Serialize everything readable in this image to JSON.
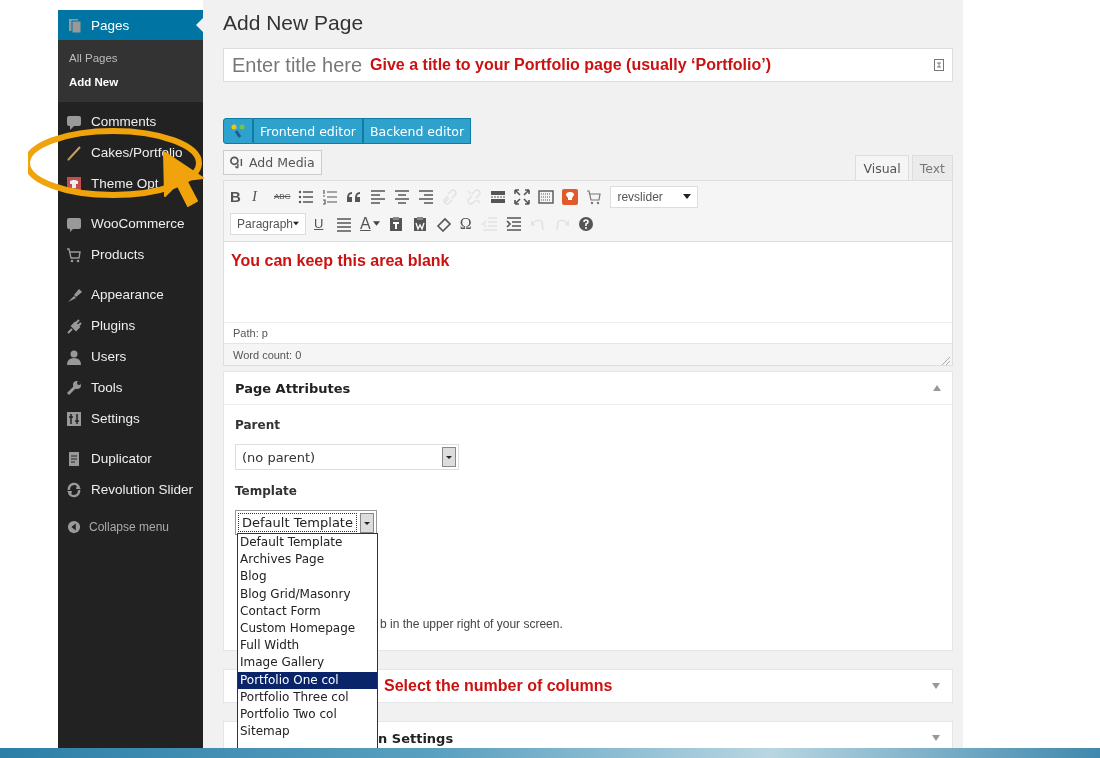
{
  "sidebar": {
    "groups": [
      {
        "items": [
          {
            "label": "Pages",
            "selected": true,
            "children": [
              {
                "label": "All Pages",
                "selected": false
              },
              {
                "label": "Add New",
                "selected": true
              }
            ]
          }
        ]
      },
      {
        "items": [
          {
            "label": "Comments",
            "selected": false
          },
          {
            "label": "Cakes/Portfolio",
            "selected": false
          },
          {
            "label": "Theme Opt",
            "selected": false
          }
        ]
      },
      {
        "items": [
          {
            "label": "WooCommerce",
            "selected": false
          },
          {
            "label": "Products",
            "selected": false
          }
        ]
      },
      {
        "items": [
          {
            "label": "Appearance",
            "selected": false
          },
          {
            "label": "Plugins",
            "selected": false
          },
          {
            "label": "Users",
            "selected": false
          },
          {
            "label": "Tools",
            "selected": false
          },
          {
            "label": "Settings",
            "selected": false
          }
        ]
      },
      {
        "items": [
          {
            "label": "Duplicator",
            "selected": false
          },
          {
            "label": "Revolution Slider",
            "selected": false
          }
        ]
      }
    ],
    "collapse_label": "Collapse menu"
  },
  "page": {
    "heading": "Add New Page",
    "title_field": {
      "placeholder": "Enter title here"
    },
    "composer_buttons": [
      "Frontend editor",
      "Backend editor"
    ],
    "add_media": "Add Media",
    "editor_tabs": [
      {
        "label": "Visual",
        "selected": true
      },
      {
        "label": "Text",
        "selected": false
      }
    ],
    "editor": {
      "toolbar_rows": [
        [
          {
            "kind": "bold",
            "text": "B",
            "disabled": false
          },
          {
            "kind": "italic",
            "text": "I",
            "disabled": false
          },
          {
            "kind": "strike",
            "text": "ABC",
            "disabled": false
          },
          {
            "kind": "bullets",
            "disabled": false
          },
          {
            "kind": "numbers",
            "disabled": false
          },
          {
            "kind": "quote",
            "disabled": false
          },
          {
            "kind": "alignleft",
            "disabled": false
          },
          {
            "kind": "aligncenter",
            "disabled": false
          },
          {
            "kind": "alignright",
            "disabled": false
          },
          {
            "kind": "link",
            "disabled": true
          },
          {
            "kind": "unlink",
            "disabled": true
          },
          {
            "kind": "more",
            "disabled": false
          },
          {
            "kind": "fullscreen",
            "disabled": false
          },
          {
            "kind": "keyboard",
            "disabled": false
          },
          {
            "kind": "chef",
            "disabled": false
          },
          {
            "kind": "cart",
            "disabled": false
          },
          {
            "kind": "select",
            "text": "revslider"
          }
        ],
        [
          {
            "kind": "select",
            "text": "Paragraph"
          },
          {
            "kind": "underline",
            "text": "U",
            "disabled": false
          },
          {
            "kind": "justify",
            "disabled": false
          },
          {
            "kind": "color",
            "text": "A",
            "disabled": false
          },
          {
            "kind": "pastetext",
            "disabled": false
          },
          {
            "kind": "pasteword",
            "disabled": false
          },
          {
            "kind": "eraser",
            "disabled": false
          },
          {
            "kind": "omega",
            "text": "Ω",
            "disabled": false
          },
          {
            "kind": "outdent",
            "disabled": true
          },
          {
            "kind": "indent",
            "disabled": false
          },
          {
            "kind": "undo",
            "disabled": true
          },
          {
            "kind": "redo",
            "disabled": true
          },
          {
            "kind": "help",
            "disabled": false
          }
        ]
      ],
      "content": "You can keep this area blank",
      "path": "Path: p",
      "word_count": "Word count: 0"
    },
    "page_attributes": {
      "title": "Page Attributes",
      "expanded": true,
      "parent_label": "Parent",
      "parent_value": "(no parent)",
      "template_label": "Template",
      "template_value": "Default Template",
      "template_options": [
        {
          "label": "Default Template",
          "selected": false
        },
        {
          "label": "Archives Page",
          "selected": false
        },
        {
          "label": "Blog",
          "selected": false
        },
        {
          "label": "Blog Grid/Masonry",
          "selected": false
        },
        {
          "label": "Contact Form",
          "selected": false
        },
        {
          "label": "Custom Homepage",
          "selected": false
        },
        {
          "label": "Full Width",
          "selected": false
        },
        {
          "label": "Image Gallery",
          "selected": false
        },
        {
          "label": "Portfolio One col",
          "selected": true
        },
        {
          "label": "Portfolio Three col",
          "selected": false
        },
        {
          "label": "Portfolio Two col",
          "selected": false
        },
        {
          "label": "Sitemap",
          "selected": false
        }
      ],
      "hint": "b in the upper right of your screen."
    },
    "collapsed_panels": [
      {
        "note": "Select the number of columns",
        "expanded": false
      },
      {
        "title": "n Settings",
        "expanded": false
      }
    ]
  },
  "annotations": {
    "title_hint": "Give a title to your Portfolio page (usually ‘Portfolio’)"
  }
}
